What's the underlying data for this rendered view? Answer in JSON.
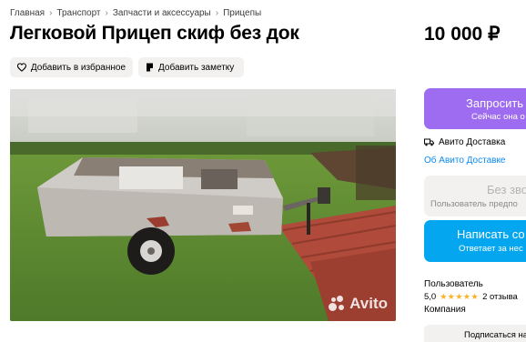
{
  "breadcrumbs": [
    {
      "label": "Главная"
    },
    {
      "label": "Транспорт"
    },
    {
      "label": "Запчасти и аксессуары"
    },
    {
      "label": "Прицепы"
    }
  ],
  "listing": {
    "title": "Легковой Прицеп скиф без док",
    "price": "10 000 ₽"
  },
  "actions": {
    "favorite_label": "Добавить в избранное",
    "note_label": "Добавить заметку"
  },
  "photo": {
    "watermark": "Avito"
  },
  "sidebar": {
    "request_label": "Запросить д",
    "request_sub": "Сейчас она о",
    "delivery_label": "Авито Доставка",
    "delivery_link": "Об Авито Доставке",
    "call_label": "Без зво",
    "call_sub": "Пользователь предпо",
    "write_label": "Написать со",
    "write_sub": "Ответает за нес",
    "seller_name": "Пользователь",
    "seller_rating": "5,0",
    "seller_stars": "★★★★★",
    "seller_reviews": "2 отзыва",
    "seller_type": "Компания",
    "subscribe_label": "Подписаться на п"
  },
  "colors": {
    "request_bg": "#9d6cf0",
    "write_bg": "#05a6f0",
    "link": "#0a8af3",
    "stars": "#ffb021",
    "pill_bg": "#f2f1f0"
  }
}
